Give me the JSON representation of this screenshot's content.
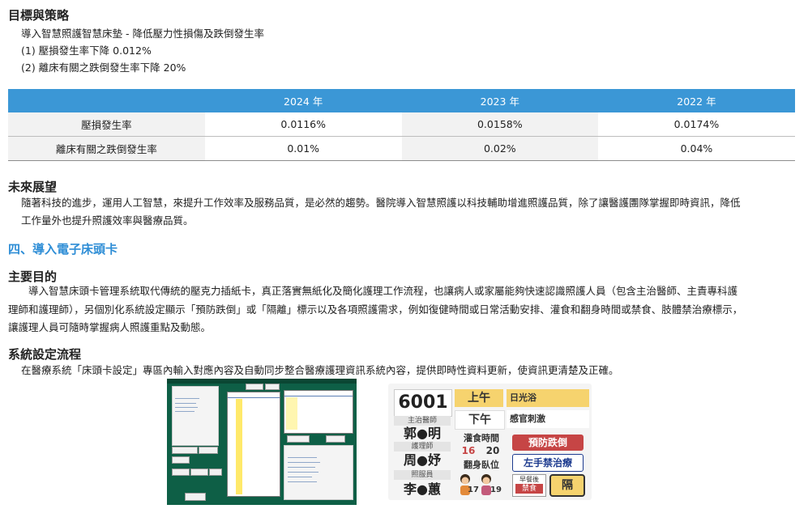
{
  "goals": {
    "heading": "目標與策略",
    "strategy": "導入智慧照護智慧床墊 - 降低壓力性損傷及跌倒發生率",
    "items": [
      "(1) 壓損發生率下降 0.012%",
      "(2) 離床有關之跌倒發生率下降 20%"
    ]
  },
  "stats_table": {
    "columns": [
      "",
      "2024 年",
      "2023 年",
      "2022 年"
    ],
    "rows": [
      {
        "label": "壓損發生率",
        "values": [
          "0.0116%",
          "0.0158%",
          "0.0174%"
        ]
      },
      {
        "label": "離床有關之跌倒發生率",
        "values": [
          "0.01%",
          "0.02%",
          "0.04%"
        ]
      }
    ]
  },
  "outlook": {
    "heading": "未來展望",
    "line1": "隨著科技的進步，運用人工智慧，來提升工作效率及服務品質，是必然的趨勢。醫院導入智慧照護以科技輔助增進照護品質，除了讓醫護團隊掌握即時資訊，降低",
    "line2": "工作量外也提升照護效率與醫療品質。"
  },
  "section4": {
    "title": "四、導入電子床頭卡"
  },
  "purpose": {
    "heading": "主要目的",
    "line1": "導入智慧床頭卡管理系統取代傳統的壓克力插紙卡，真正落實無紙化及簡化護理工作流程，也讓病人或家屬能夠快速認識照護人員（包含主治醫師、主責專科護",
    "line2": "理師和護理師），另個別化系統設定顯示「預防跌倒」或「隔離」標示以及各項照護需求，例如復健時間或日常活動安排、灌食和翻身時間或禁食、肢體禁治療標示，",
    "line3": "讓護理人員可隨時掌握病人照護重點及動態。"
  },
  "process": {
    "heading": "系統設定流程",
    "line1": "在醫療系統「床頭卡設定」專區內輸入對應內容及自動同步整合醫療護理資訊系統內容，提供即時性資料更新，使資訊更清楚及正確。"
  },
  "bedside_card": {
    "bed_no": "6001",
    "am_label": "上午",
    "am_activity": "日光浴",
    "pm_label": "下午",
    "pm_activity": "感官刺激",
    "attending_label": "主治醫師",
    "attending_name": "郭●明",
    "feeding_label": "灌食時間",
    "feeding_times": [
      "16",
      "20"
    ],
    "nurse_label": "護理師",
    "nurse_name": "周●妤",
    "turning_label": "翻身臥位",
    "fall_tag": "預防跌倒",
    "restraint_tag": "左手禁治療",
    "caregiver_label": "照服員",
    "caregiver_name": "李●蕙",
    "fasting_tag_line1": "早餐後",
    "fasting_tag_line2": "禁食",
    "isolation_tag": "隔",
    "turn_times": [
      "17",
      "19"
    ]
  },
  "colors": {
    "accent": "#3b97d6",
    "section_title": "#2f8ed6",
    "screen_bg": "#0e5f46",
    "card_yellow": "#f6d36e",
    "fall_red": "#c64545",
    "restraint_blue": "#1d3b8f"
  }
}
